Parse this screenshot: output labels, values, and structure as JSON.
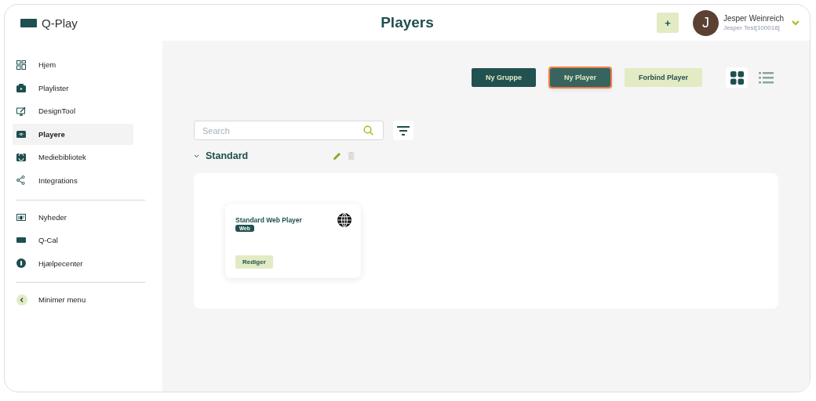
{
  "brand": {
    "name": "Q-Play"
  },
  "header": {
    "title": "Players",
    "add_button": "+",
    "user": {
      "initial": "J",
      "name": "Jesper Weinreich",
      "account": "Jesper Test[100016]"
    }
  },
  "sidebar": {
    "groups": [
      {
        "items": [
          {
            "label": "Hjem",
            "kind": "grid",
            "selected": false
          },
          {
            "label": "Playlister",
            "kind": "playlist",
            "selected": false
          },
          {
            "label": "DesignTool",
            "kind": "design",
            "selected": false
          },
          {
            "label": "Playere",
            "kind": "player",
            "selected": true
          },
          {
            "label": "Mediebibliotek",
            "kind": "media",
            "selected": false
          },
          {
            "label": "Integrations",
            "kind": "share",
            "selected": false
          }
        ]
      },
      {
        "items": [
          {
            "label": "Nyheder",
            "kind": "news",
            "selected": false
          },
          {
            "label": "Q-Cal",
            "kind": "cal",
            "selected": false
          },
          {
            "label": "Hjælpecenter",
            "kind": "info",
            "selected": false
          }
        ]
      },
      {
        "items": [
          {
            "label": "Minimer menu",
            "kind": "collapse",
            "selected": false
          }
        ]
      }
    ]
  },
  "toolbar": {
    "buttons": [
      {
        "label": "Ny Gruppe",
        "kind": "primary",
        "focused": false
      },
      {
        "label": "Ny Player",
        "kind": "primary",
        "focused": true
      },
      {
        "label": "Forbind Player",
        "kind": "secondary",
        "focused": false
      }
    ],
    "views": [
      {
        "kind": "grid",
        "selected": true
      },
      {
        "kind": "list",
        "selected": false
      }
    ]
  },
  "search": {
    "placeholder": "Search"
  },
  "groups": [
    {
      "name": "Standard",
      "expanded": true,
      "players": [
        {
          "title": "Standard Web Player",
          "tag": "Web",
          "action": "Rediger"
        }
      ]
    }
  ]
}
